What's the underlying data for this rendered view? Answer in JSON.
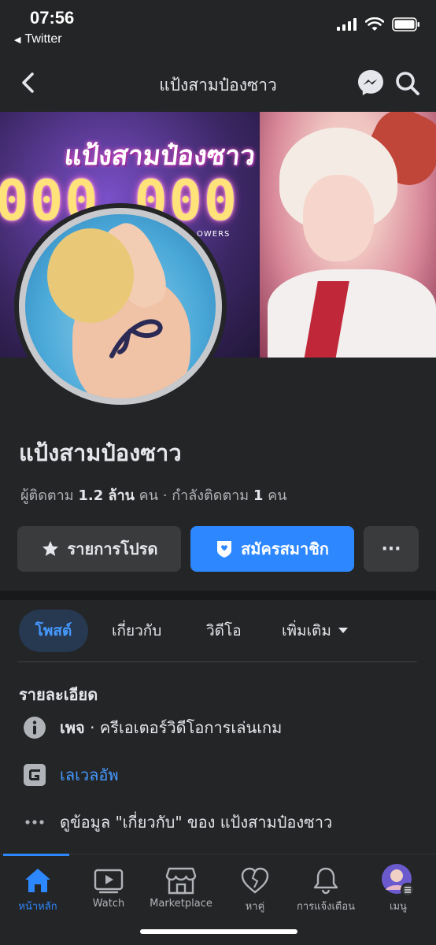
{
  "status_bar": {
    "time": "07:56",
    "back_app": "Twitter"
  },
  "nav": {
    "title": "แป้งสามป๋องซาว"
  },
  "cover": {
    "title_text": "แป้งสามป๋องซาว",
    "number_text": "000,000",
    "followers_text": "OWERS"
  },
  "profile": {
    "name": "แป้งสามป๋องซาว",
    "followers_label": "ผู้ติดตาม",
    "followers_value": "1.2 ล้าน",
    "followers_unit": "คน",
    "separator": "·",
    "following_label": "กำลังติดตาม",
    "following_value": "1",
    "following_unit": "คน"
  },
  "actions": {
    "favorite": "รายการโปรด",
    "subscribe": "สมัครสมาชิก",
    "more": "···"
  },
  "tabs": {
    "posts": "โพสต์",
    "about": "เกี่ยวกับ",
    "videos": "วิดีโอ",
    "more": "เพิ่มเติม"
  },
  "details": {
    "title": "รายละเอียด",
    "category_prefix": "เพจ",
    "category": " · ครีเอเตอร์วิดีโอการเล่นเกม",
    "link": "เลเวลอัพ",
    "about_link": "ดูข้อมูล \"เกี่ยวกับ\" ของ แป้งสามป๋องซาว"
  },
  "tabbar": {
    "home": "หน้าหลัก",
    "watch": "Watch",
    "marketplace": "Marketplace",
    "dating": "หาคู่",
    "notifications": "การแจ้งเตือน",
    "menu": "เมนู"
  },
  "colors": {
    "accent": "#2d88ff",
    "background": "#242526",
    "button_gray": "#3a3b3c"
  }
}
